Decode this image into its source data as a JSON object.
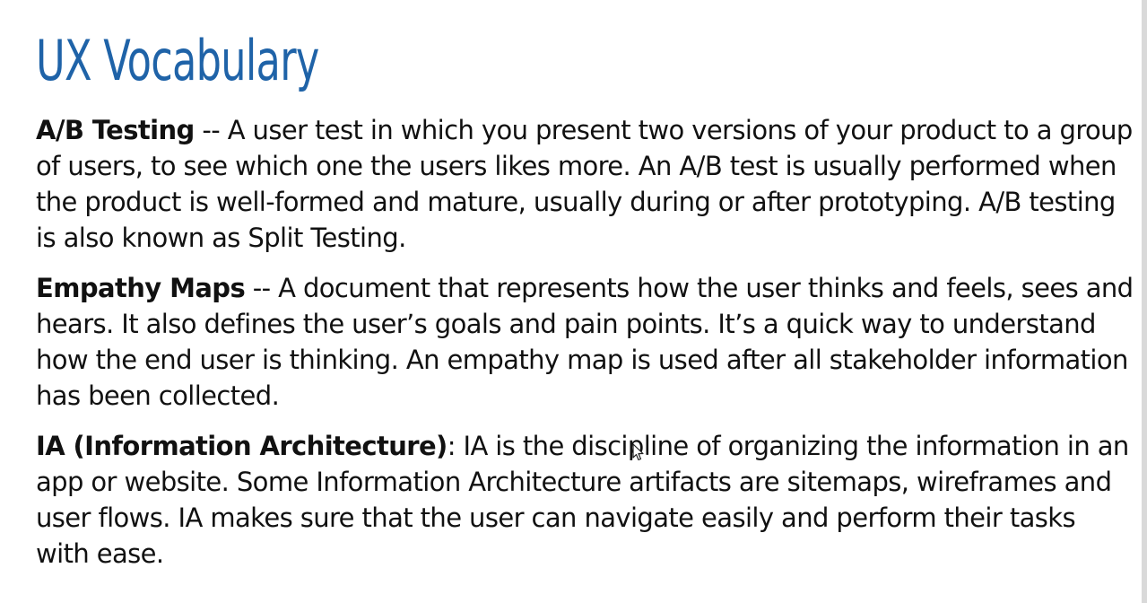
{
  "slide": {
    "title": "UX Vocabulary",
    "terms": [
      {
        "name": "A/B Testing",
        "separator": " -- ",
        "definition": "A user test in which you present two versions of your product to a group of users, to see which one the users likes more. An A/B test is usually performed when the product is well-formed and mature, usually during or after prototyping. A/B testing is also known as Split Testing."
      },
      {
        "name": "Empathy Maps",
        "separator": " -- ",
        "definition": "A document that represents how the user thinks and feels, sees and hears. It also defines the user’s goals and pain points. It’s a quick way to understand how the end user is thinking.  An empathy map is used after all stakeholder information has been collected."
      },
      {
        "name": "IA (Information Architecture)",
        "separator": ": ",
        "definition": "IA is the discipline of organizing the information in an app or website. Some Information Architecture artifacts are sitemaps, wireframes and user flows. IA makes sure that the user can navigate easily and perform their tasks with ease."
      }
    ]
  },
  "colors": {
    "title": "#1f63a8",
    "text": "#111111",
    "background": "#ffffff"
  },
  "icons": {
    "cursor": "mouse-pointer-icon"
  }
}
